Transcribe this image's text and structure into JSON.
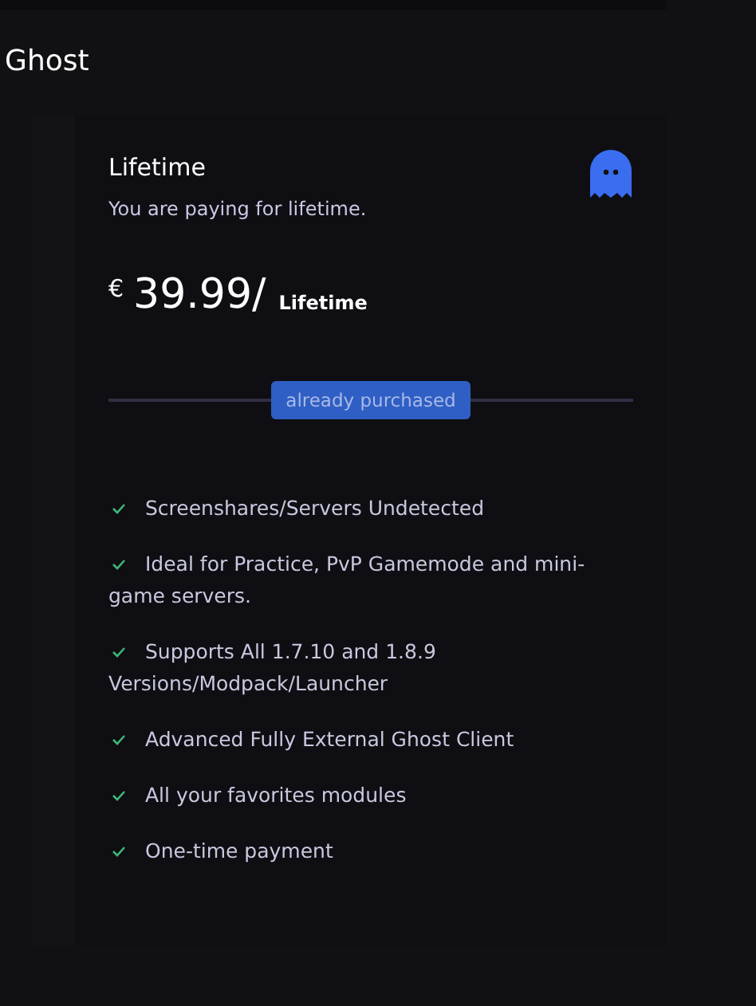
{
  "page": {
    "title": "Ghost"
  },
  "plan": {
    "name": "Lifetime",
    "description": "You are paying for lifetime.",
    "currency": "€",
    "price": "39.99/",
    "period": "Lifetime",
    "status_button": "already purchased"
  },
  "features": [
    {
      "text": "Screenshares/Servers Undetected",
      "checked": true
    },
    {
      "text": "Ideal for Practice, PvP Gamemode and mini-game servers.",
      "checked": true
    },
    {
      "text": "Supports All 1.7.10 and 1.8.9 Versions/Modpack/Launcher",
      "checked": true
    },
    {
      "text": "Advanced Fully External Ghost Client",
      "checked": true
    },
    {
      "text": "All your favorites modules",
      "checked": true
    },
    {
      "text": "One-time payment",
      "checked": true
    }
  ]
}
